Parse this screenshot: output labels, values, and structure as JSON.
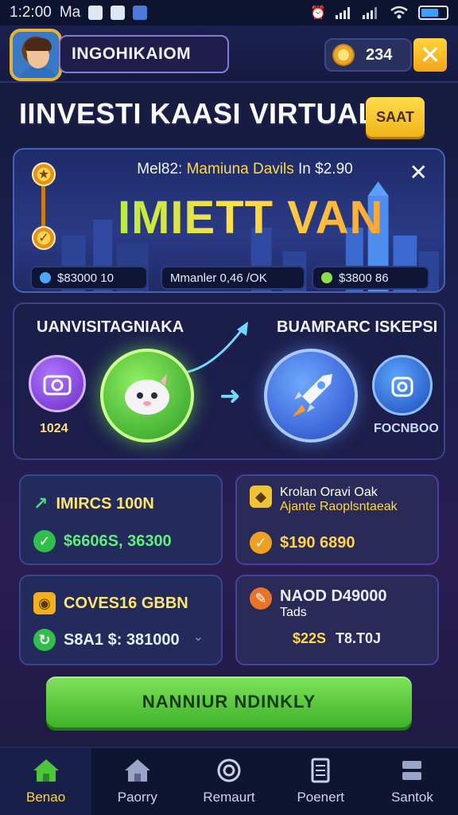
{
  "status_bar": {
    "time": "1:2:00",
    "carrier": "Ma"
  },
  "header": {
    "username": "INGOHIKAIOM",
    "coins": "234"
  },
  "page": {
    "title": "IINVESTI KAASI VIRTUAL",
    "start_button": "SAAT"
  },
  "hero": {
    "subtitle_pre": "Mel82:",
    "subtitle_accent": "Mamiuna Davils",
    "subtitle_post": "In $2.90",
    "headline": "IMIETT VAN",
    "stats": [
      "$83000 10",
      "Mmanler 0,46 /OK",
      "$3800 86"
    ],
    "colors": {
      "headline_start": "#a8f03c",
      "headline_end": "#ff9a2a"
    }
  },
  "flow": {
    "left_title": "UANVISITAGNIAKA",
    "right_title": "BUAMRARC ISKEPSI",
    "left_value": "1024",
    "right_label": "FOCNBOO"
  },
  "cards": [
    {
      "title": "IMIRCS 100N",
      "value": "$6606S, 36300"
    },
    {
      "title": "Krolan Oravi Oak",
      "subtitle": "Ajante Raoplsntaeak",
      "value": "$190 6890"
    },
    {
      "title": "COVES16 GBBN",
      "value": "S8A1 $: 381000"
    },
    {
      "title": "NAOD D49000",
      "subtitle": "Tads",
      "value_accent": "$22S",
      "value_rest": "T8.T0J"
    }
  ],
  "cta": {
    "label": "NANNIUR NDINKLY"
  },
  "nav": [
    {
      "label": "Benao",
      "icon": "home-icon",
      "active": true
    },
    {
      "label": "Paorry",
      "icon": "house-icon",
      "active": false
    },
    {
      "label": "Remaurt",
      "icon": "globe-icon",
      "active": false
    },
    {
      "label": "Poenert",
      "icon": "document-icon",
      "active": false
    },
    {
      "label": "Santok",
      "icon": "server-icon",
      "active": false
    }
  ]
}
